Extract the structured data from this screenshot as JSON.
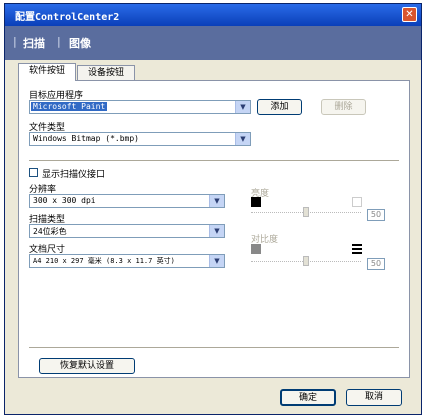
{
  "window": {
    "title": "配置ControlCenter2",
    "close_glyph": "✕"
  },
  "banner": {
    "scan": "扫描",
    "image": "图像",
    "separator": "|"
  },
  "tabs": [
    {
      "label": "软件按钮",
      "active": true
    },
    {
      "label": "设备按钮",
      "active": false
    }
  ],
  "target_app": {
    "label": "目标应用程序",
    "value": "Microsoft Paint",
    "add_button": "添加",
    "delete_button": "删除"
  },
  "file_type": {
    "label": "文件类型",
    "value": "Windows Bitmap (*.bmp)"
  },
  "show_scanner_interface": {
    "label": "显示扫描仪接口",
    "checked": false
  },
  "resolution": {
    "label": "分辨率",
    "value": "300 x 300 dpi"
  },
  "scan_type": {
    "label": "扫描类型",
    "value": "24位彩色"
  },
  "document_size": {
    "label": "文档尺寸",
    "value": "A4 210 x 297 毫米 (8.3 x 11.7 英寸)"
  },
  "brightness": {
    "label": "亮度",
    "value": "50",
    "level": 0.5
  },
  "contrast": {
    "label": "对比度",
    "value": "50",
    "level": 0.5
  },
  "restore_defaults": {
    "label": "恢复默认设置"
  },
  "footer": {
    "ok": "确定",
    "cancel": "取消"
  }
}
